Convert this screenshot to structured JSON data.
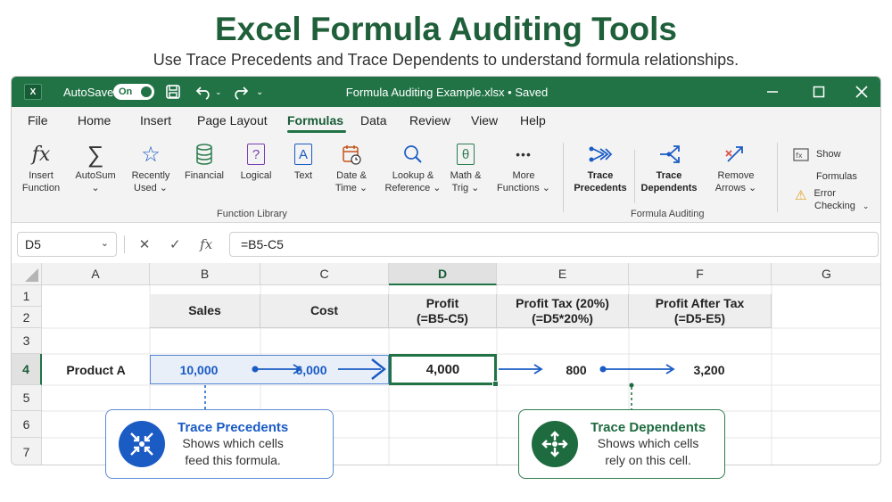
{
  "header": {
    "title": "Excel Formula Auditing Tools",
    "subtitle": "Use Trace Precedents and Trace Dependents to understand formula relationships."
  },
  "titlebar": {
    "logo": "X",
    "autosave_label": "AutoSave",
    "autosave_state": "On",
    "document_title": "Formula Auditing Example.xlsx  •  Saved",
    "chevron": "⌄"
  },
  "menu": {
    "items": [
      "File",
      "Home",
      "Insert",
      "Page Layout",
      "Formulas",
      "Data",
      "Review",
      "View",
      "Help"
    ],
    "active": "Formulas"
  },
  "ribbon": {
    "function_library": {
      "label": "Function Library",
      "buttons": [
        {
          "line1": "Insert",
          "line2": "Function",
          "icon": "fx-icon"
        },
        {
          "line1": "AutoSum",
          "line2": "⌄",
          "icon": "sigma-icon"
        },
        {
          "line1": "Recently",
          "line2": "Used ⌄",
          "icon": "star-icon"
        },
        {
          "line1": "Financial",
          "line2": "",
          "icon": "database-icon"
        },
        {
          "line1": "Logical",
          "line2": "",
          "icon": "question-icon"
        },
        {
          "line1": "Text",
          "line2": "",
          "icon": "text-icon"
        },
        {
          "line1": "Date &",
          "line2": "Time ⌄",
          "icon": "calendar-icon"
        },
        {
          "line1": "Lookup &",
          "line2": "Reference ⌄",
          "icon": "magnifier-icon"
        },
        {
          "line1": "Math &",
          "line2": "Trig ⌄",
          "icon": "theta-icon"
        },
        {
          "line1": "More",
          "line2": "Functions ⌄",
          "icon": "more-icon"
        }
      ],
      "fx_glyph": "fx",
      "sigma_glyph": "∑",
      "star_glyph": "☆",
      "question_glyph": "?",
      "text_glyph": "A",
      "theta_glyph": "θ",
      "more_glyph": "•••"
    },
    "formula_auditing": {
      "label": "Formula Auditing",
      "buttons": [
        {
          "line1": "Trace",
          "line2": "Precedents",
          "icon": "trace-precedents-icon"
        },
        {
          "line1": "Trace",
          "line2": "Dependents",
          "icon": "trace-dependents-icon"
        },
        {
          "line1": "Remove",
          "line2": "Arrows ⌄",
          "icon": "remove-arrows-icon"
        }
      ],
      "show_formulas_line1": "Show",
      "show_formulas_line2": "Formulas",
      "error_checking_line1": "Error",
      "error_checking_line2": "Checking",
      "error_chevron": "⌄",
      "warning_glyph": "⚠"
    }
  },
  "formula_bar": {
    "name_box": "D5",
    "name_chevron": "⌄",
    "cancel_glyph": "✕",
    "enter_glyph": "✓",
    "fx_glyph": "fx",
    "formula": "=B5-C5"
  },
  "sheet": {
    "columns": [
      "A",
      "B",
      "C",
      "D",
      "E",
      "F",
      "G"
    ],
    "selected_column": "D",
    "rows": [
      "1",
      "2",
      "3",
      "4",
      "5",
      "6",
      "7"
    ],
    "selected_row": "4",
    "headers": {
      "sales": "Sales",
      "cost": "Cost",
      "profit_line1": "Profit",
      "profit_line2": "(=B5-C5)",
      "tax_line1": "Profit Tax (20%)",
      "tax_line2": "(=D5*20%)",
      "after_line1": "Profit After Tax",
      "after_line2": "(=D5-E5)"
    },
    "data_row": {
      "label": "Product A",
      "sales": "10,000",
      "cost": "6,000",
      "profit": "4,000",
      "tax": "800",
      "after_tax": "3,200"
    }
  },
  "callouts": {
    "precedents": {
      "title": "Trace Precedents",
      "line1": "Shows which cells",
      "line2": "feed this formula."
    },
    "dependents": {
      "title": "Trace Dependents",
      "line1": "Shows which cells",
      "line2": "rely on this cell."
    }
  },
  "colors": {
    "excel_green": "#217346",
    "title_green": "#1f5f3a",
    "precedent_blue": "#1a5bc4",
    "dependent_green": "#1f6b40"
  }
}
